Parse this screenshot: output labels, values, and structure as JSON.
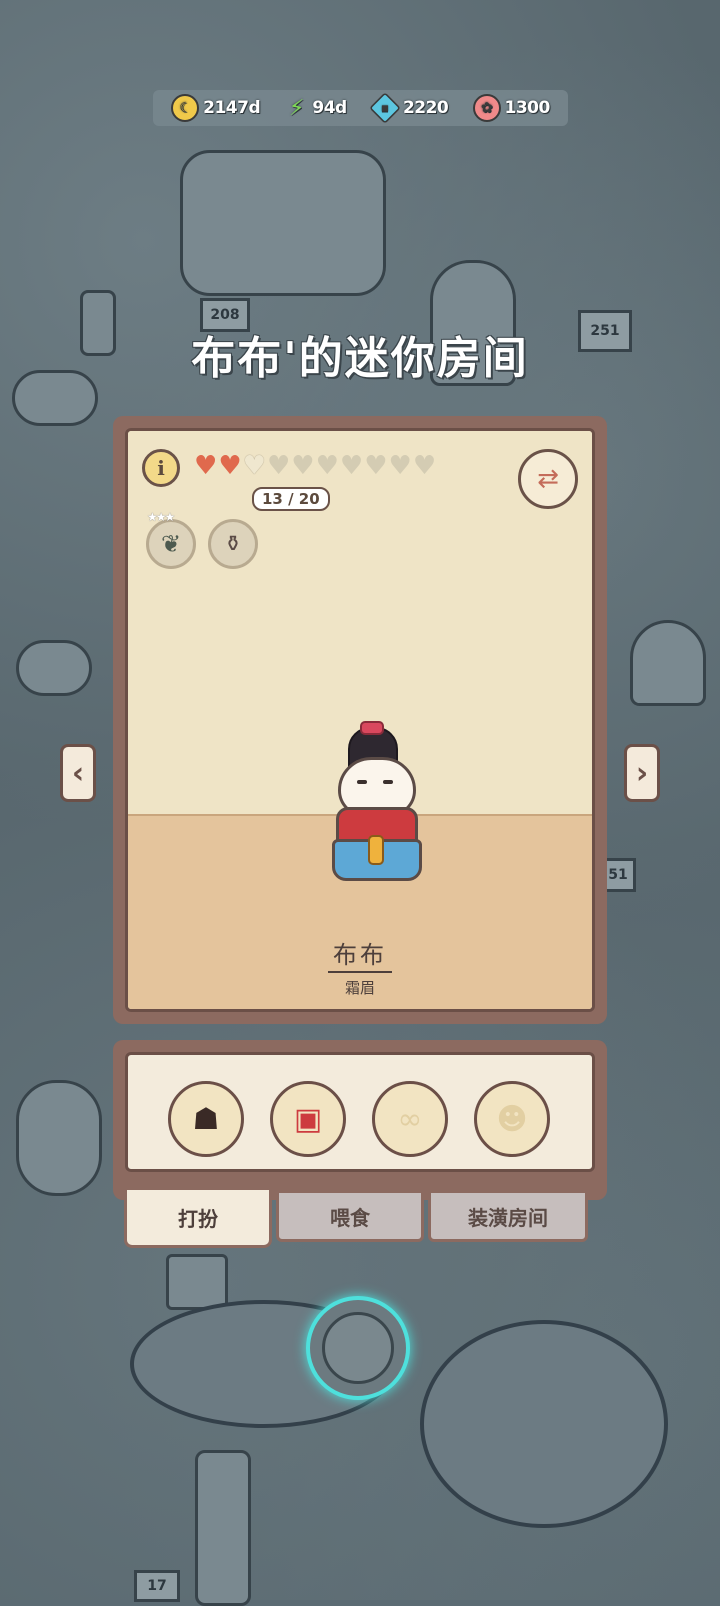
{
  "currency": [
    {
      "name": "coins",
      "value": "2147d",
      "icon": "coin-icon",
      "color": "#f0c94a"
    },
    {
      "name": "energy",
      "value": "94d",
      "icon": "lightning-icon",
      "color": "#7ed957"
    },
    {
      "name": "gems",
      "value": "2220",
      "icon": "gem-icon",
      "color": "#5cc6e0"
    },
    {
      "name": "tokens",
      "value": "1300",
      "icon": "token-icon",
      "color": "#f08a8a"
    }
  ],
  "room": {
    "title": "布布'的迷你房间",
    "affection": "13 / 20",
    "hearts_filled": 2,
    "hearts_total": 10,
    "cat_name": "布布",
    "cat_title": "霜眉"
  },
  "background_signs": {
    "sign_208": "208",
    "sign_251": "251",
    "sign_51": "51",
    "sign_17": "17"
  },
  "tabs": {
    "dress": "打扮",
    "feed": "喂食",
    "decorate": "装潢房间"
  },
  "tools": [
    {
      "name": "hat-tool",
      "icon": "hat-icon"
    },
    {
      "name": "outfit-tool",
      "icon": "outfit-icon"
    },
    {
      "name": "glasses-tool",
      "icon": "glasses-icon"
    },
    {
      "name": "mask-tool",
      "icon": "mask-icon"
    }
  ]
}
